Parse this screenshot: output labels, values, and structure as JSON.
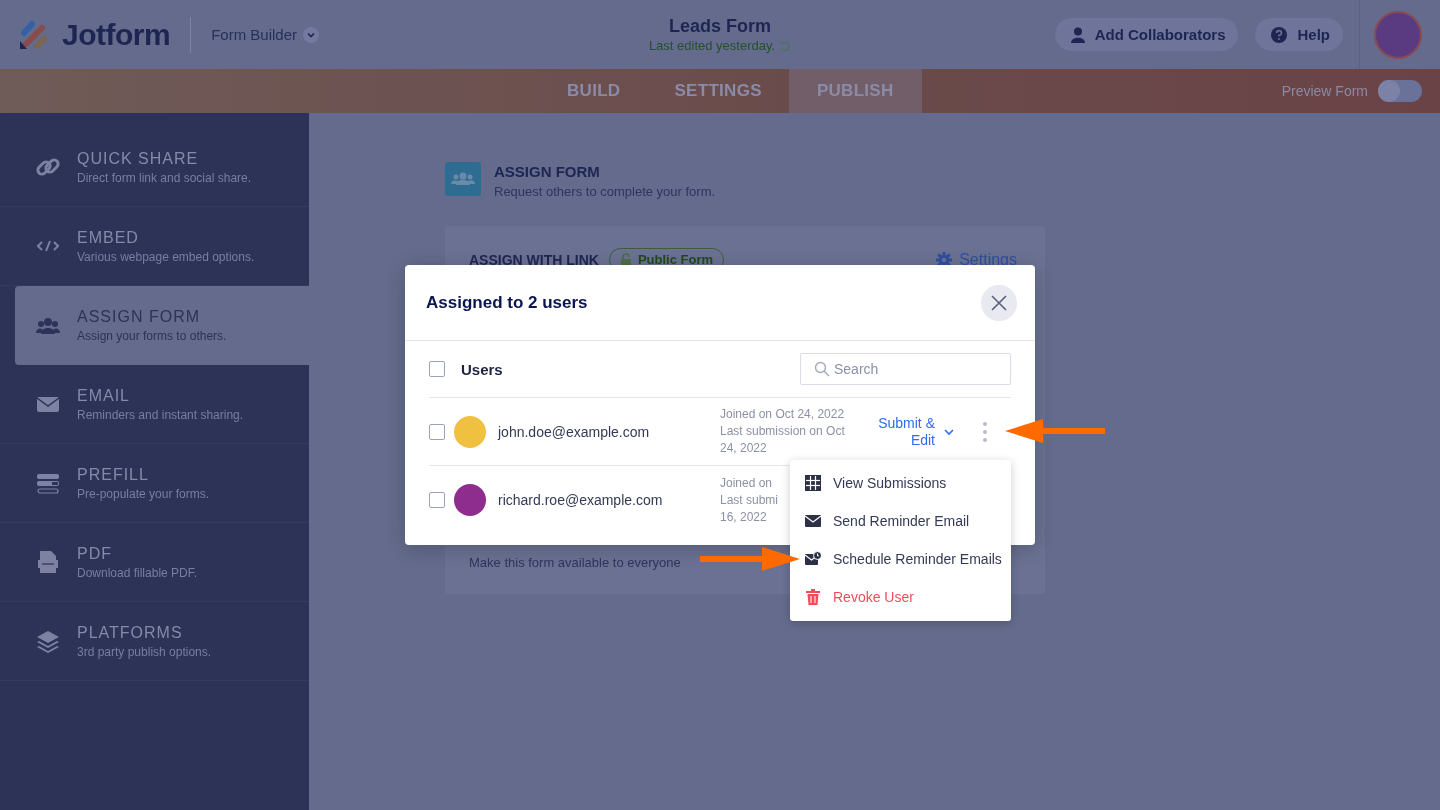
{
  "header": {
    "logo": "Jotform",
    "app_switcher": "Form Builder",
    "form_title": "Leads Form",
    "last_edited": "Last edited yesterday.",
    "buttons": [
      {
        "kind": "collaborators",
        "label": "Add Collaborators"
      },
      {
        "kind": "help",
        "label": "Help"
      }
    ]
  },
  "tabs": [
    {
      "label": "BUILD",
      "selected": false
    },
    {
      "label": "SETTINGS",
      "selected": false
    },
    {
      "label": "PUBLISH",
      "selected": true
    }
  ],
  "preview": {
    "label": "Preview Form",
    "on": false
  },
  "sidebar": {
    "items": [
      {
        "kind": "link",
        "title": "QUICK SHARE",
        "subtitle": "Direct form link and social share.",
        "selected": false
      },
      {
        "kind": "code",
        "title": "EMBED",
        "subtitle": "Various webpage embed options.",
        "selected": false
      },
      {
        "kind": "users",
        "title": "ASSIGN FORM",
        "subtitle": "Assign your forms to others.",
        "selected": true
      },
      {
        "kind": "mail",
        "title": "EMAIL",
        "subtitle": "Reminders and instant sharing.",
        "selected": false
      },
      {
        "kind": "prefill",
        "title": "PREFILL",
        "subtitle": "Pre-populate your forms.",
        "selected": false
      },
      {
        "kind": "pdf",
        "title": "PDF",
        "subtitle": "Download fillable PDF.",
        "selected": false
      },
      {
        "kind": "layers",
        "title": "PLATFORMS",
        "subtitle": "3rd party publish options.",
        "selected": false
      }
    ]
  },
  "section": {
    "title": "ASSIGN FORM",
    "subtitle": "Request others to complete your form."
  },
  "card": {
    "title": "ASSIGN WITH LINK",
    "badge": "Public Form",
    "settings": "Settings",
    "note": "Make this form available to everyone"
  },
  "modal": {
    "title": "Assigned to 2 users",
    "column": "Users",
    "all_checked": false,
    "search_placeholder": "Search",
    "users": [
      {
        "email": "john.doe@example.com",
        "checked": false,
        "color": "#f0c040",
        "meta": [
          "Joined on Oct 24, 2022",
          "Last submission on Oct",
          "24, 2022"
        ],
        "action": "Submit & Edit"
      },
      {
        "email": "richard.roe@example.com",
        "checked": false,
        "color": "#8e2d8e",
        "meta": [
          "Joined on",
          "Last submi",
          "16, 2022"
        ]
      }
    ]
  },
  "menu": {
    "items": [
      {
        "kind": "grid",
        "label": "View Submissions"
      },
      {
        "kind": "mail",
        "label": "Send Reminder Email"
      },
      {
        "kind": "schedule",
        "label": "Schedule Reminder Emails"
      },
      {
        "kind": "delete",
        "label": "Revoke User"
      }
    ]
  }
}
